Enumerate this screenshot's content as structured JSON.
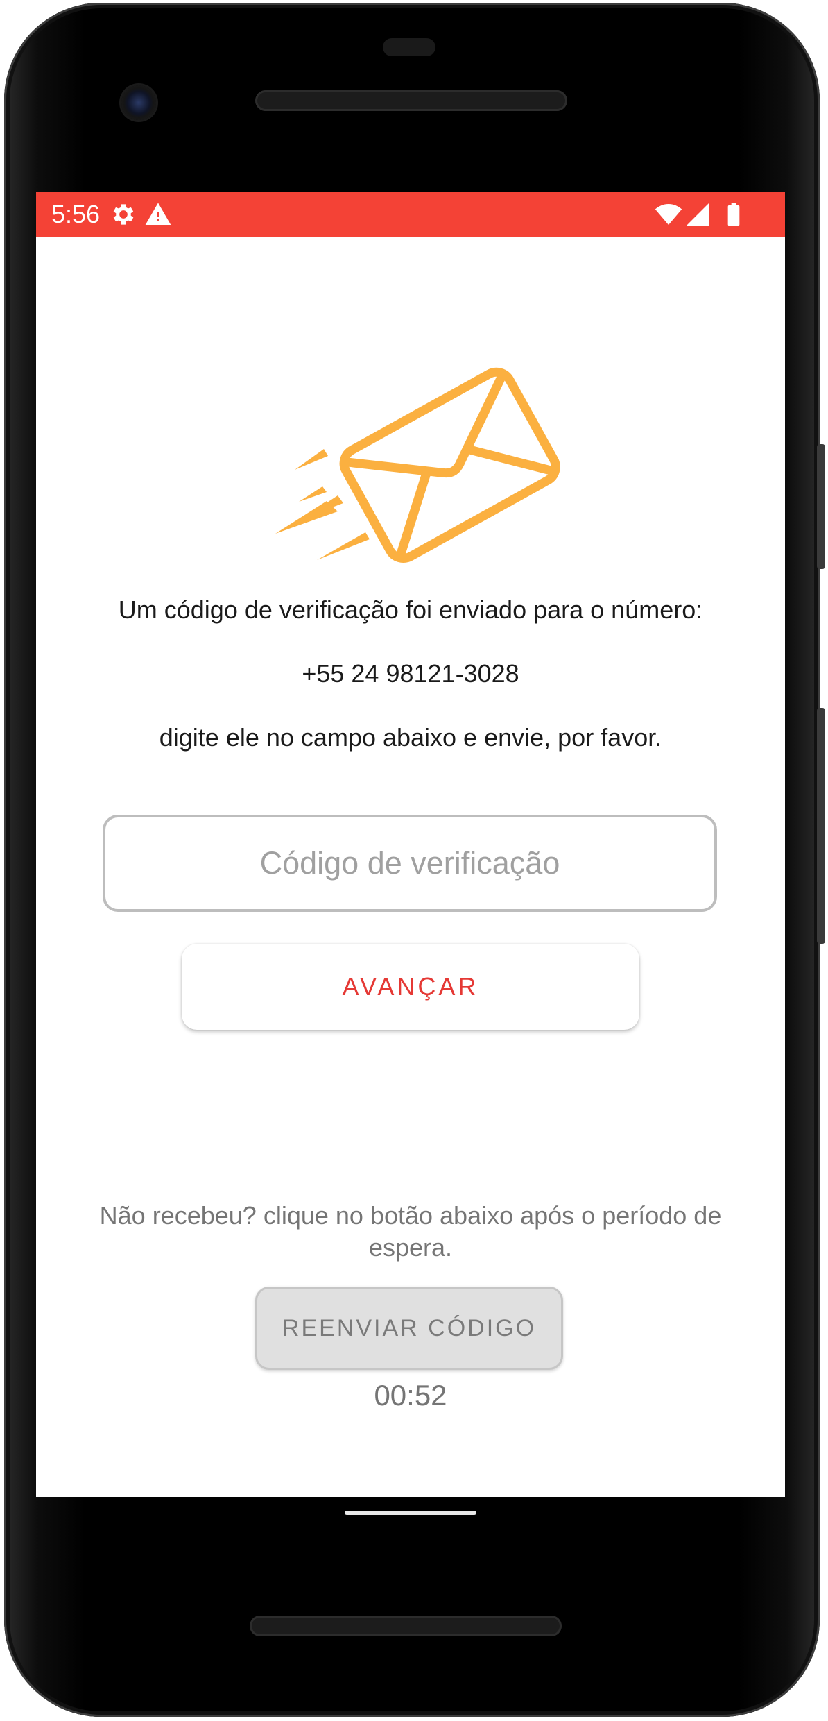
{
  "status_bar": {
    "time": "5:56",
    "color": "#f44236",
    "icons": [
      "gear-icon",
      "warning-icon",
      "wifi-icon",
      "signal-icon",
      "battery-icon"
    ]
  },
  "illustration": {
    "icon": "flying-envelope-icon",
    "color": "#fbb040"
  },
  "message": {
    "line1": "Um código de verificação foi enviado para o número:",
    "phone": "+55 24 98121-3028",
    "line2": "digite ele no campo abaixo e envie, por favor."
  },
  "code_input": {
    "placeholder": "Código de verificação",
    "value": ""
  },
  "advance_button": {
    "label": "AVANÇAR",
    "color": "#e53935"
  },
  "resend": {
    "hint": "Não recebeu? clique no botão abaixo após o período de espera.",
    "button_label": "REENVIAR CÓDIGO",
    "timer": "00:52"
  }
}
